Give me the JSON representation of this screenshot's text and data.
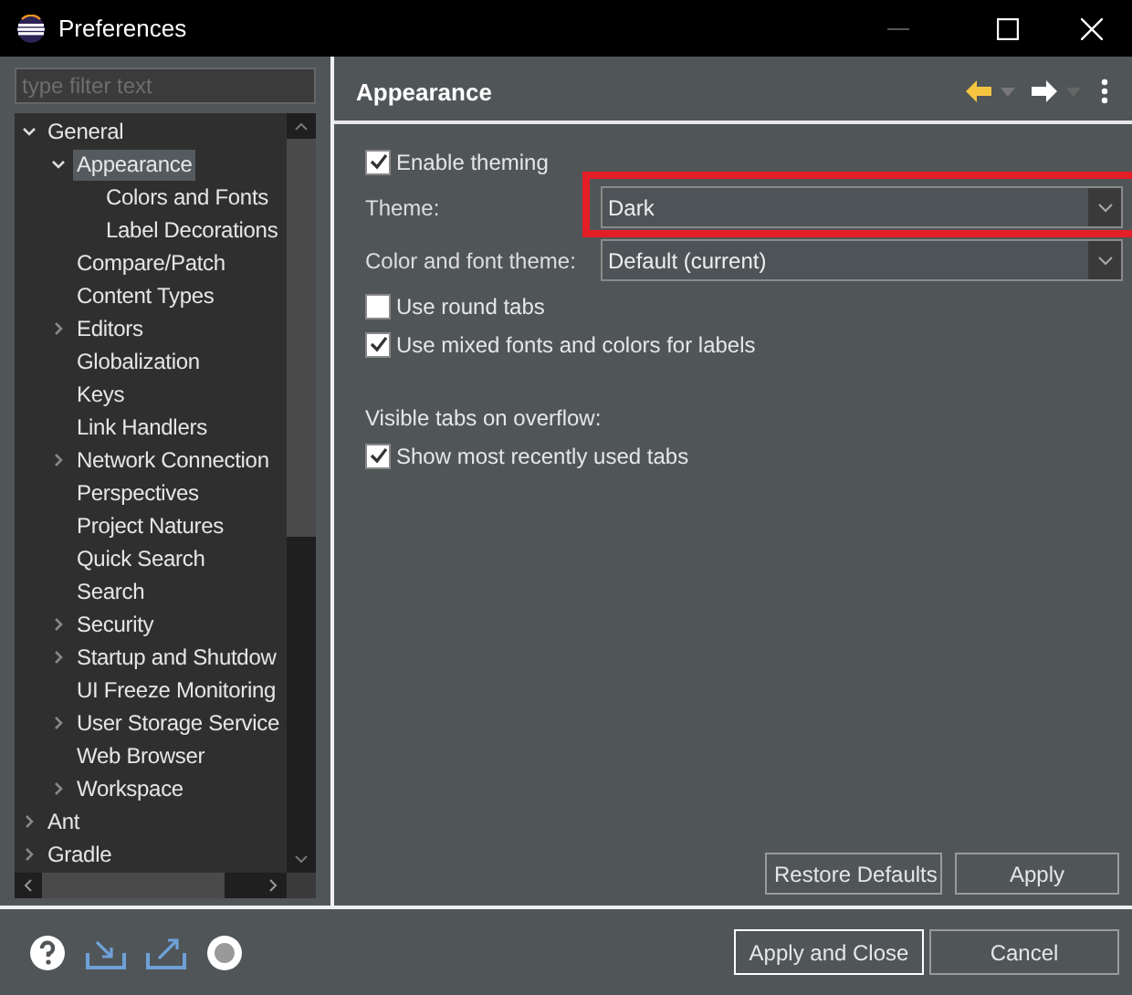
{
  "window": {
    "title": "Preferences"
  },
  "sidebar": {
    "filter": {
      "placeholder": "type filter text"
    },
    "tree": [
      {
        "label": "General",
        "selected": false,
        "expanded": true,
        "children": [
          {
            "label": "Appearance",
            "selected": true,
            "expanded": true,
            "children": [
              {
                "label": "Colors and Fonts",
                "selected": false
              },
              {
                "label": "Label Decorations",
                "selected": false
              }
            ]
          },
          {
            "label": "Compare/Patch",
            "selected": false
          },
          {
            "label": "Content Types",
            "selected": false
          },
          {
            "label": "Editors",
            "selected": false,
            "expanded": false
          },
          {
            "label": "Globalization",
            "selected": false
          },
          {
            "label": "Keys",
            "selected": false
          },
          {
            "label": "Link Handlers",
            "selected": false
          },
          {
            "label": "Network Connection",
            "selected": false,
            "expanded": false
          },
          {
            "label": "Perspectives",
            "selected": false
          },
          {
            "label": "Project Natures",
            "selected": false
          },
          {
            "label": "Quick Search",
            "selected": false
          },
          {
            "label": "Search",
            "selected": false
          },
          {
            "label": "Security",
            "selected": false,
            "expanded": false
          },
          {
            "label": "Startup and Shutdow",
            "selected": false,
            "expanded": false
          },
          {
            "label": "UI Freeze Monitoring",
            "selected": false
          },
          {
            "label": "User Storage Service",
            "selected": false,
            "expanded": false
          },
          {
            "label": "Web Browser",
            "selected": false
          },
          {
            "label": "Workspace",
            "selected": false,
            "expanded": false
          }
        ]
      },
      {
        "label": "Ant",
        "selected": false,
        "expanded": false
      },
      {
        "label": "Gradle",
        "selected": false,
        "expanded": false
      }
    ]
  },
  "page": {
    "title": "Appearance",
    "settings": [
      {
        "kind": "checkbox",
        "label": "Enable theming",
        "checked": true
      },
      {
        "kind": "combo",
        "label": "Theme:",
        "value": "Dark",
        "highlighted": true
      },
      {
        "kind": "combo",
        "label": "Color and font theme:",
        "value": "Default (current)",
        "highlighted": false
      },
      {
        "kind": "checkbox",
        "label": "Use round tabs",
        "checked": false
      },
      {
        "kind": "checkbox",
        "label": "Use mixed fonts and colors for labels",
        "checked": true
      },
      {
        "kind": "heading",
        "label": "Visible tabs on overflow:"
      },
      {
        "kind": "checkbox",
        "label": "Show most recently used tabs",
        "checked": true
      }
    ],
    "buttons": [
      "Restore Defaults",
      "Apply"
    ]
  },
  "footer": {
    "buttons": [
      {
        "label": "Apply and Close",
        "default": true
      },
      {
        "label": "Cancel",
        "default": false
      }
    ]
  }
}
